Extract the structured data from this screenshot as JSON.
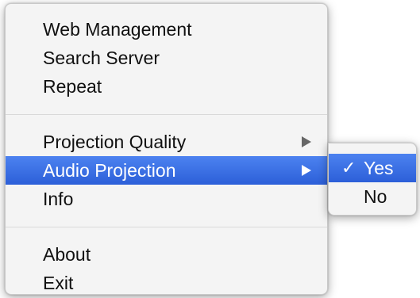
{
  "menu": {
    "group1": [
      {
        "label": "Web Management"
      },
      {
        "label": "Search Server"
      },
      {
        "label": "Repeat"
      }
    ],
    "group2": [
      {
        "label": "Projection Quality",
        "submenu": true,
        "icon": "chevron-right-icon"
      },
      {
        "label": "Audio Projection",
        "submenu": true,
        "icon": "chevron-right-icon",
        "highlighted": true
      },
      {
        "label": "Info"
      }
    ],
    "group3": [
      {
        "label": "About"
      },
      {
        "label": "Exit"
      }
    ]
  },
  "submenu": {
    "items": [
      {
        "label": "Yes",
        "checked": true,
        "check_glyph": "✓",
        "highlighted": true
      },
      {
        "label": "No",
        "checked": false
      }
    ]
  },
  "colors": {
    "highlight": "#3a6fe0",
    "menu_background": "#f4f4f4",
    "text": "#111111"
  }
}
